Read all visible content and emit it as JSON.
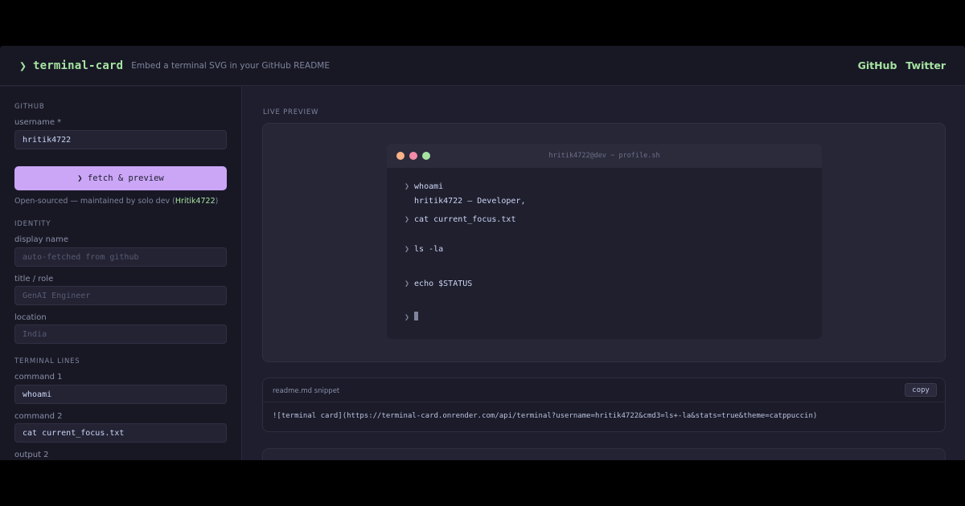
{
  "header": {
    "chevron": "❯",
    "app_name": "terminal-card",
    "tagline": "Embed a terminal SVG in your GitHub README",
    "links": [
      "GitHub",
      "Twitter"
    ]
  },
  "sidebar": {
    "github_section": "GITHUB",
    "username_label": "username *",
    "username_value": "hritik4722",
    "fetch_button": "❯ fetch & preview",
    "oss_note_prefix": "Open-sourced — maintained by solo dev (",
    "oss_note_link": "Hritik4722",
    "oss_note_suffix": ")",
    "identity_section": "IDENTITY",
    "display_name_label": "display name",
    "display_name_placeholder": "auto-fetched from github",
    "title_label": "title / role",
    "title_placeholder": "GenAI Engineer",
    "location_label": "location",
    "location_placeholder": "India",
    "terminal_section": "TERMINAL LINES",
    "command1_label": "command 1",
    "command1_value": "whoami",
    "command2_label": "command 2",
    "command2_value": "cat current_focus.txt",
    "output2_label": "output 2"
  },
  "main": {
    "live_preview_title": "LIVE PREVIEW",
    "terminal": {
      "window_title": "hritik4722@dev ~ profile.sh",
      "prompt": "❯",
      "cmd1": "whoami",
      "out1": "hritik4722 — Developer,",
      "cmd2": "cat current_focus.txt",
      "cmd3": "ls -la",
      "cmd4": "echo $STATUS"
    },
    "snippet": {
      "label": "readme.md snippet",
      "copy_button": "copy",
      "code": "![terminal card](https://terminal-card.onrender.com/api/terminal?username=hritik4722&cmd3=ls+-la&stats=true&theme=catppuccin)"
    }
  },
  "colors": {
    "accent_green": "#a6e3a1",
    "accent_purple": "#cba6f7",
    "background": "#1e1e2e",
    "surface": "#181825"
  }
}
